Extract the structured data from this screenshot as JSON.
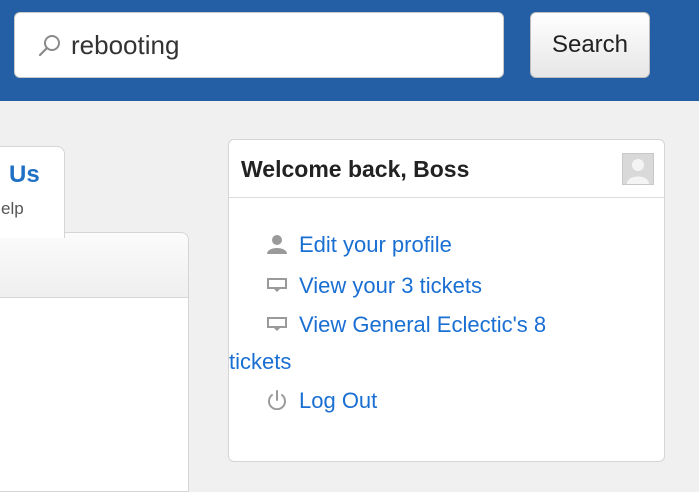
{
  "search": {
    "value": "rebooting",
    "button_label": "Search"
  },
  "left_tab": {
    "title": "Us",
    "subtitle": "elp"
  },
  "welcome": {
    "title": "Welcome back, Boss",
    "items": [
      {
        "label": "Edit your profile",
        "icon": "user-icon"
      },
      {
        "label": "View your 3 tickets",
        "icon": "ticket-icon"
      },
      {
        "label_line1": "View General Eclectic's 8",
        "label_line2": "tickets",
        "icon": "ticket-icon"
      },
      {
        "label": "Log Out",
        "icon": "power-icon"
      }
    ]
  },
  "colors": {
    "topbar": "#245ea5",
    "link": "#1a6fd3",
    "background": "#f0f0f0"
  }
}
